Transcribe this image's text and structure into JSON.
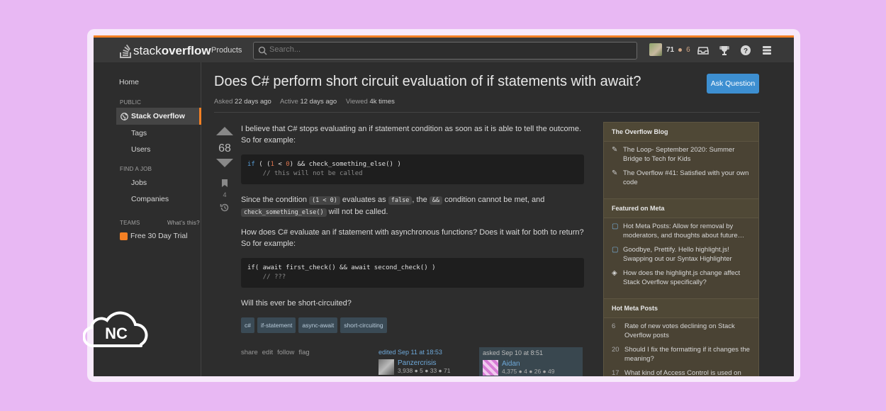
{
  "topbar": {
    "logo_stack": "stack",
    "logo_overflow": "overflow",
    "products_label": "Products",
    "search_placeholder": "Search...",
    "reputation": "71",
    "bronze_badges": "6"
  },
  "sidebar": {
    "home": "Home",
    "public_heading": "PUBLIC",
    "stack_overflow": "Stack Overflow",
    "tags": "Tags",
    "users": "Users",
    "find_job_heading": "FIND A JOB",
    "jobs": "Jobs",
    "companies": "Companies",
    "teams_heading": "TEAMS",
    "whats_this": "What's this?",
    "free_trial": "Free 30 Day Trial"
  },
  "question": {
    "title": "Does C# perform short circuit evaluation of if statements with await?",
    "ask_button": "Ask Question",
    "asked_label": "Asked",
    "asked_value": "22 days ago",
    "active_label": "Active",
    "active_value": "12 days ago",
    "viewed_label": "Viewed",
    "viewed_value": "4k times",
    "vote_count": "68",
    "bookmark_count": "4",
    "para1": "I believe that C# stops evaluating an if statement condition as soon as it is able to tell the outcome. So for example:",
    "para2_a": "Since the condition",
    "para2_code1": "(1 < 0)",
    "para2_b": "evaluates as",
    "para2_code2": "false",
    "para2_c": ", the",
    "para2_code3": "&&",
    "para2_d": "condition cannot be met, and",
    "para2_code4": "check_something_else()",
    "para2_e": "will not be called.",
    "para3": "How does C# evaluate an if statement with asynchronous functions? Does it wait for both to return? So for example:",
    "para4": "Will this ever be short-circuited?",
    "tags": [
      "c#",
      "if-statement",
      "async-await",
      "short-circuiting"
    ],
    "actions": [
      "share",
      "edit",
      "follow",
      "flag"
    ],
    "edited_label": "edited Sep 11 at 18:53",
    "editor_name": "Panzercrisis",
    "editor_rep": "3,938 ● 5 ● 33 ● 71",
    "asked_by_label": "asked Sep 10 at 8:51",
    "asker_name": "Aidan",
    "asker_rep": "4,375 ● 4 ● 26 ● 49"
  },
  "code1": {
    "line1": ") && check_something_else() )",
    "line2": "// this will not be called"
  },
  "code2": {
    "line1": "if( await first_check() && await second_check() )",
    "line2": "// ???"
  },
  "rightcol": {
    "blog_heading": "The Overflow Blog",
    "blog_items": [
      "The Loop- September 2020: Summer Bridge to Tech for Kids",
      "The Overflow #41: Satisfied with your own code"
    ],
    "meta_heading": "Featured on Meta",
    "meta_items": [
      "Hot Meta Posts: Allow for removal by moderators, and thoughts about future…",
      "Goodbye, Prettify. Hello highlight.js! Swapping out our Syntax Highlighter",
      "How does the highlight.js change affect Stack Overflow specifically?"
    ],
    "hot_heading": "Hot Meta Posts",
    "hot_items": [
      {
        "num": "6",
        "text": "Rate of new votes declining on Stack Overflow posts"
      },
      {
        "num": "20",
        "text": "Should I fix the formatting if it changes the meaning?"
      },
      {
        "num": "17",
        "text": "What kind of Access Control is used on"
      }
    ]
  },
  "badge": {
    "text": "NC"
  },
  "colors": {
    "accent": "#f48024",
    "link": "#6ea8d8",
    "button": "#3d8fd1",
    "background": "#e8b8f3"
  }
}
